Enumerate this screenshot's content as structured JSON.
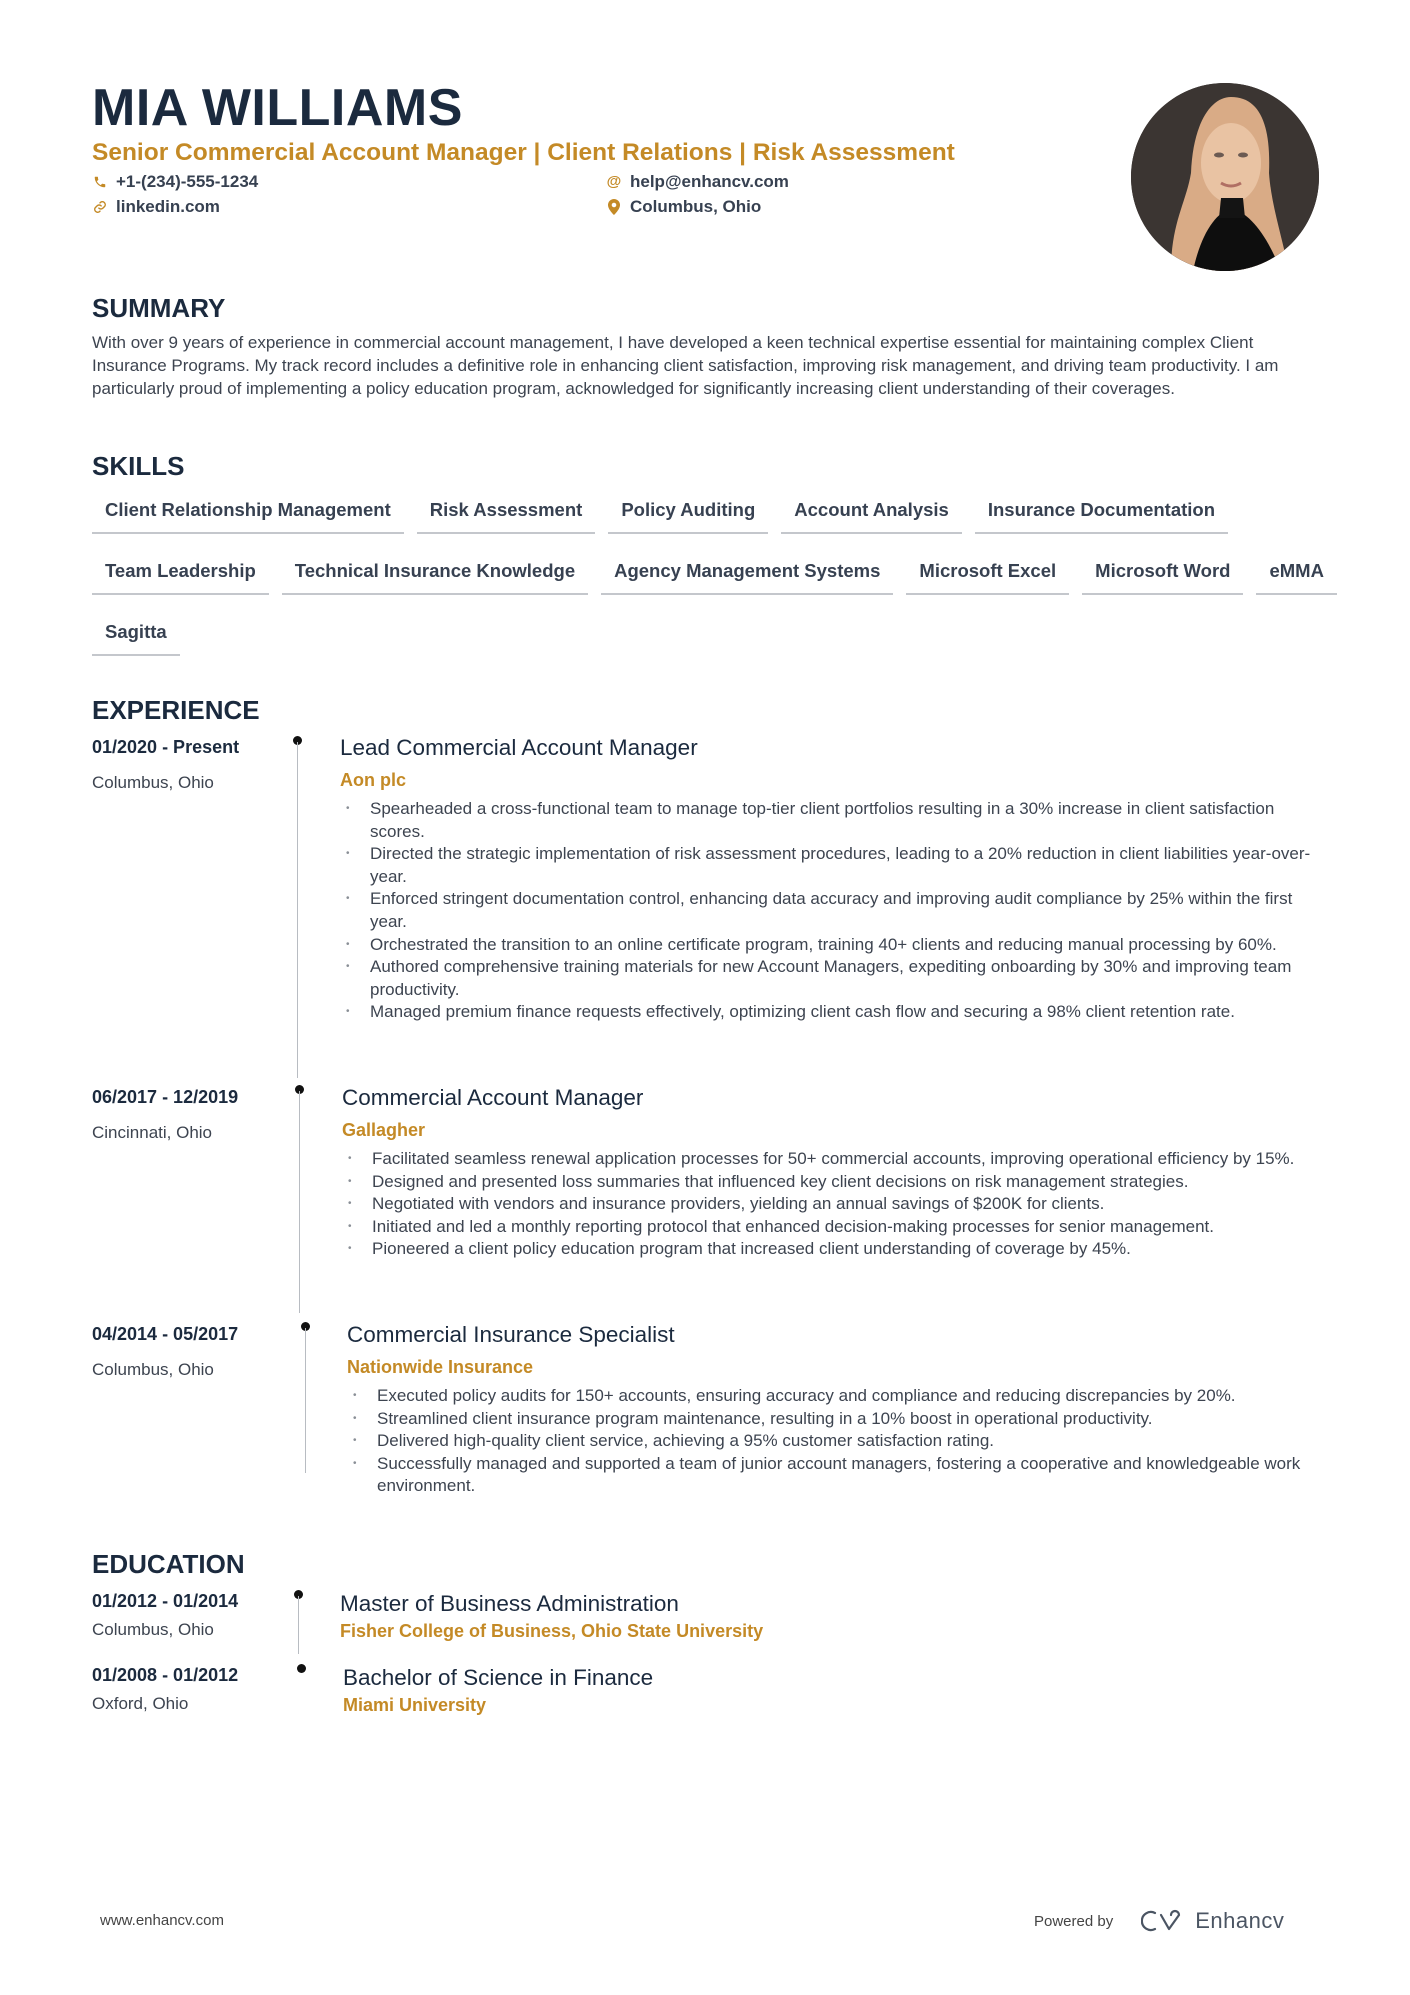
{
  "header": {
    "name": "MIA WILLIAMS",
    "subtitle": "Senior Commercial Account Manager | Client Relations | Risk Assessment",
    "contacts": {
      "phone": {
        "icon": "phone-icon",
        "text": "+1-(234)-555-1234"
      },
      "email": {
        "icon": "at-icon",
        "text": "help@enhancv.com"
      },
      "linkedin": {
        "icon": "link-icon",
        "text": "linkedin.com"
      },
      "location": {
        "icon": "location-pin-icon",
        "text": "Columbus, Ohio"
      }
    }
  },
  "colors": {
    "accent": "#c48a26",
    "heading": "#1b2a3e",
    "body": "#3d4450"
  },
  "summary": {
    "title": "SUMMARY",
    "text": "With over 9 years of experience in commercial account management, I have developed a keen technical expertise essential for maintaining complex Client Insurance Programs. My track record includes a definitive role in enhancing client satisfaction, improving risk management, and driving team productivity. I am particularly proud of implementing a policy education program, acknowledged for significantly increasing client understanding of their coverages."
  },
  "skills": {
    "title": "SKILLS",
    "items": [
      "Client Relationship Management",
      "Risk Assessment",
      "Policy Auditing",
      "Account Analysis",
      "Insurance Documentation",
      "Team Leadership",
      "Technical Insurance Knowledge",
      "Agency Management Systems",
      "Microsoft Excel",
      "Microsoft Word",
      "eMMA",
      "Sagitta"
    ]
  },
  "experience": {
    "title": "EXPERIENCE",
    "jobs": [
      {
        "dates": "01/2020 - Present",
        "location": "Columbus, Ohio",
        "role": "Lead Commercial Account Manager",
        "company": "Aon plc",
        "bullets": [
          "Spearheaded a cross-functional team to manage top-tier client portfolios resulting in a 30% increase in client satisfaction scores.",
          "Directed the strategic implementation of risk assessment procedures, leading to a 20% reduction in client liabilities year-over-year.",
          "Enforced stringent documentation control, enhancing data accuracy and improving audit compliance by 25% within the first year.",
          "Orchestrated the transition to an online certificate program, training 40+ clients and reducing manual processing by 60%.",
          "Authored comprehensive training materials for new Account Managers, expediting onboarding by 30% and improving team productivity.",
          "Managed premium finance requests effectively, optimizing client cash flow and securing a 98% client retention rate."
        ]
      },
      {
        "dates": "06/2017 - 12/2019",
        "location": "Cincinnati, Ohio",
        "role": "Commercial Account Manager",
        "company": "Gallagher",
        "bullets": [
          "Facilitated seamless renewal application processes for 50+ commercial accounts, improving operational efficiency by 15%.",
          "Designed and presented loss summaries that influenced key client decisions on risk management strategies.",
          "Negotiated with vendors and insurance providers, yielding an annual savings of $200K for clients.",
          "Initiated and led a monthly reporting protocol that enhanced decision-making processes for senior management.",
          "Pioneered a client policy education program that increased client understanding of coverage by 45%."
        ]
      },
      {
        "dates": "04/2014 - 05/2017",
        "location": "Columbus, Ohio",
        "role": "Commercial Insurance Specialist",
        "company": "Nationwide Insurance",
        "bullets": [
          "Executed policy audits for 150+ accounts, ensuring accuracy and compliance and reducing discrepancies by 20%.",
          "Streamlined client insurance program maintenance, resulting in a 10% boost in operational productivity.",
          "Delivered high-quality client service, achieving a 95% customer satisfaction rating.",
          "Successfully managed and supported a team of junior account managers, fostering a cooperative and knowledgeable work environment."
        ]
      }
    ]
  },
  "education": {
    "title": "EDUCATION",
    "items": [
      {
        "dates": "01/2012 - 01/2014",
        "location": "Columbus, Ohio",
        "degree": "Master of Business Administration",
        "school": "Fisher College of Business, Ohio State University"
      },
      {
        "dates": "01/2008 - 01/2012",
        "location": "Oxford, Ohio",
        "degree": "Bachelor of Science in Finance",
        "school": "Miami University"
      }
    ]
  },
  "footer": {
    "url": "www.enhancv.com",
    "powered_by": "Powered by",
    "brand": "Enhancv",
    "brand_icon": "enhancv-logo-icon"
  }
}
